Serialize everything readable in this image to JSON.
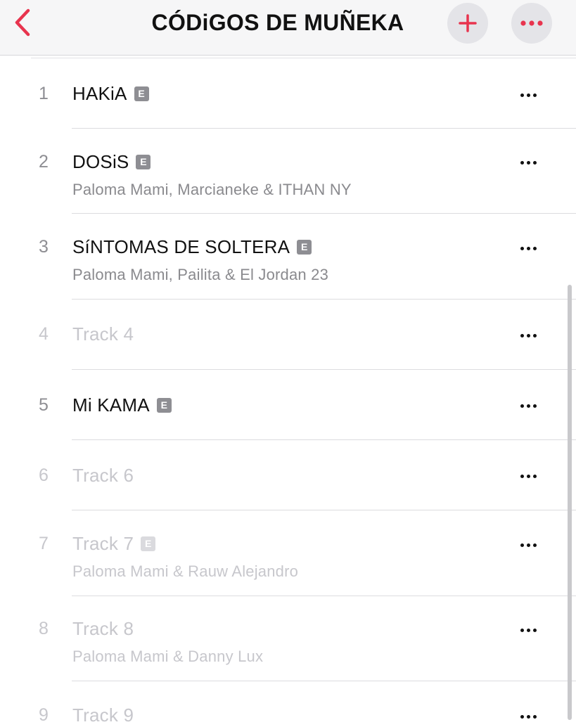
{
  "nav": {
    "title": "CÓDiGOS DE MUÑEKA",
    "back_icon": "chevron-left-icon",
    "add_icon": "plus-icon",
    "more_icon": "ellipsis-icon",
    "accent_color": "#e8344e"
  },
  "tracks": [
    {
      "number": "1",
      "title": "HAKiA",
      "explicit": true,
      "artist": "",
      "available": true
    },
    {
      "number": "2",
      "title": "DOSiS",
      "explicit": true,
      "artist": "Paloma Mami, Marcianeke & ITHAN NY",
      "available": true
    },
    {
      "number": "3",
      "title": "SíNTOMAS DE SOLTERA",
      "explicit": true,
      "artist": "Paloma Mami, Pailita & El Jordan 23",
      "available": true
    },
    {
      "number": "4",
      "title": "Track 4",
      "explicit": false,
      "artist": "",
      "available": false
    },
    {
      "number": "5",
      "title": "Mi KAMA",
      "explicit": true,
      "artist": "",
      "available": true
    },
    {
      "number": "6",
      "title": "Track 6",
      "explicit": false,
      "artist": "",
      "available": false
    },
    {
      "number": "7",
      "title": "Track 7",
      "explicit": true,
      "artist": "Paloma Mami & Rauw Alejandro",
      "available": false
    },
    {
      "number": "8",
      "title": "Track 8",
      "explicit": false,
      "artist": "Paloma Mami & Danny Lux",
      "available": false
    },
    {
      "number": "9",
      "title": "Track 9",
      "explicit": false,
      "artist": "",
      "available": false
    }
  ],
  "explicit_badge": "E"
}
